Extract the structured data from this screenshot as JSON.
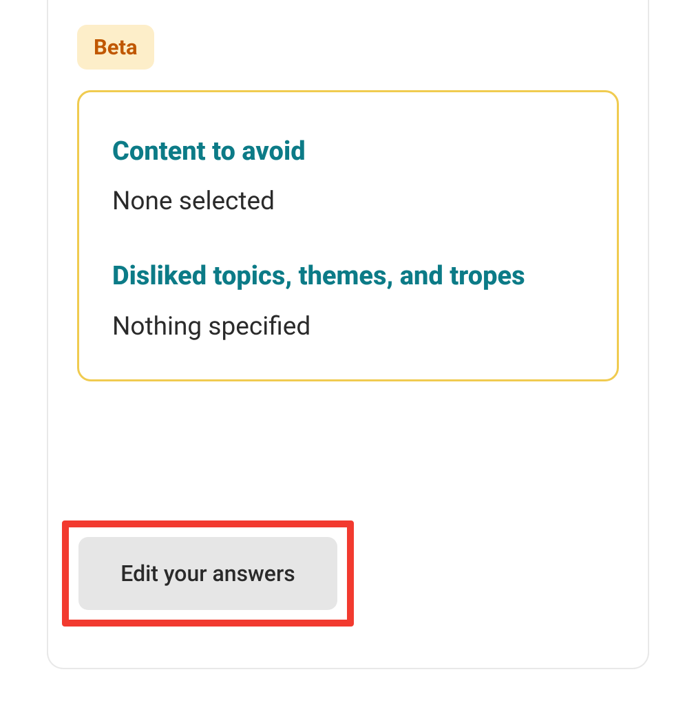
{
  "badge": {
    "label": "Beta"
  },
  "sections": [
    {
      "heading": "Content to avoid",
      "value": "None selected"
    },
    {
      "heading": "Disliked topics, themes, and tropes",
      "value": "Nothing specified"
    }
  ],
  "button": {
    "edit_label": "Edit your answers"
  }
}
